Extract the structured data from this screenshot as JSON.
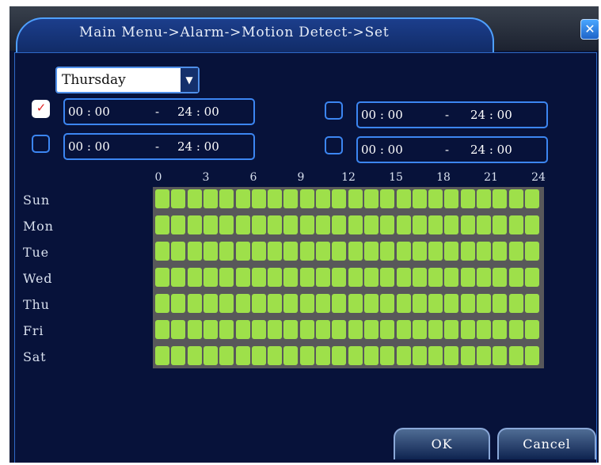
{
  "window": {
    "title": "Main Menu->Alarm->Motion Detect->Set",
    "close_glyph": "✕"
  },
  "day_selector": {
    "value": "Thursday",
    "arrow_glyph": "▼"
  },
  "periods": [
    {
      "checked": true,
      "start": "00 : 00",
      "separator": "-",
      "end": "24 : 00"
    },
    {
      "checked": false,
      "start": "00 : 00",
      "separator": "-",
      "end": "24 : 00"
    },
    {
      "checked": false,
      "start": "00 : 00",
      "separator": "-",
      "end": "24 : 00"
    },
    {
      "checked": false,
      "start": "00 : 00",
      "separator": "-",
      "end": "24 : 00"
    }
  ],
  "checkbox_mark": "✓",
  "schedule": {
    "hour_labels": [
      "0",
      "3",
      "6",
      "9",
      "12",
      "15",
      "18",
      "21",
      "24"
    ],
    "days": [
      "Sun",
      "Mon",
      "Tue",
      "Wed",
      "Thu",
      "Fri",
      "Sat"
    ],
    "cell_color": "#9ee04a",
    "grid_color": "#58585a",
    "enabled_hours": [
      [
        1,
        1,
        1,
        1,
        1,
        1,
        1,
        1,
        1,
        1,
        1,
        1,
        1,
        1,
        1,
        1,
        1,
        1,
        1,
        1,
        1,
        1,
        1,
        1
      ],
      [
        1,
        1,
        1,
        1,
        1,
        1,
        1,
        1,
        1,
        1,
        1,
        1,
        1,
        1,
        1,
        1,
        1,
        1,
        1,
        1,
        1,
        1,
        1,
        1
      ],
      [
        1,
        1,
        1,
        1,
        1,
        1,
        1,
        1,
        1,
        1,
        1,
        1,
        1,
        1,
        1,
        1,
        1,
        1,
        1,
        1,
        1,
        1,
        1,
        1
      ],
      [
        1,
        1,
        1,
        1,
        1,
        1,
        1,
        1,
        1,
        1,
        1,
        1,
        1,
        1,
        1,
        1,
        1,
        1,
        1,
        1,
        1,
        1,
        1,
        1
      ],
      [
        1,
        1,
        1,
        1,
        1,
        1,
        1,
        1,
        1,
        1,
        1,
        1,
        1,
        1,
        1,
        1,
        1,
        1,
        1,
        1,
        1,
        1,
        1,
        1
      ],
      [
        1,
        1,
        1,
        1,
        1,
        1,
        1,
        1,
        1,
        1,
        1,
        1,
        1,
        1,
        1,
        1,
        1,
        1,
        1,
        1,
        1,
        1,
        1,
        1
      ],
      [
        1,
        1,
        1,
        1,
        1,
        1,
        1,
        1,
        1,
        1,
        1,
        1,
        1,
        1,
        1,
        1,
        1,
        1,
        1,
        1,
        1,
        1,
        1,
        1
      ]
    ]
  },
  "buttons": {
    "ok": "OK",
    "cancel": "Cancel"
  }
}
